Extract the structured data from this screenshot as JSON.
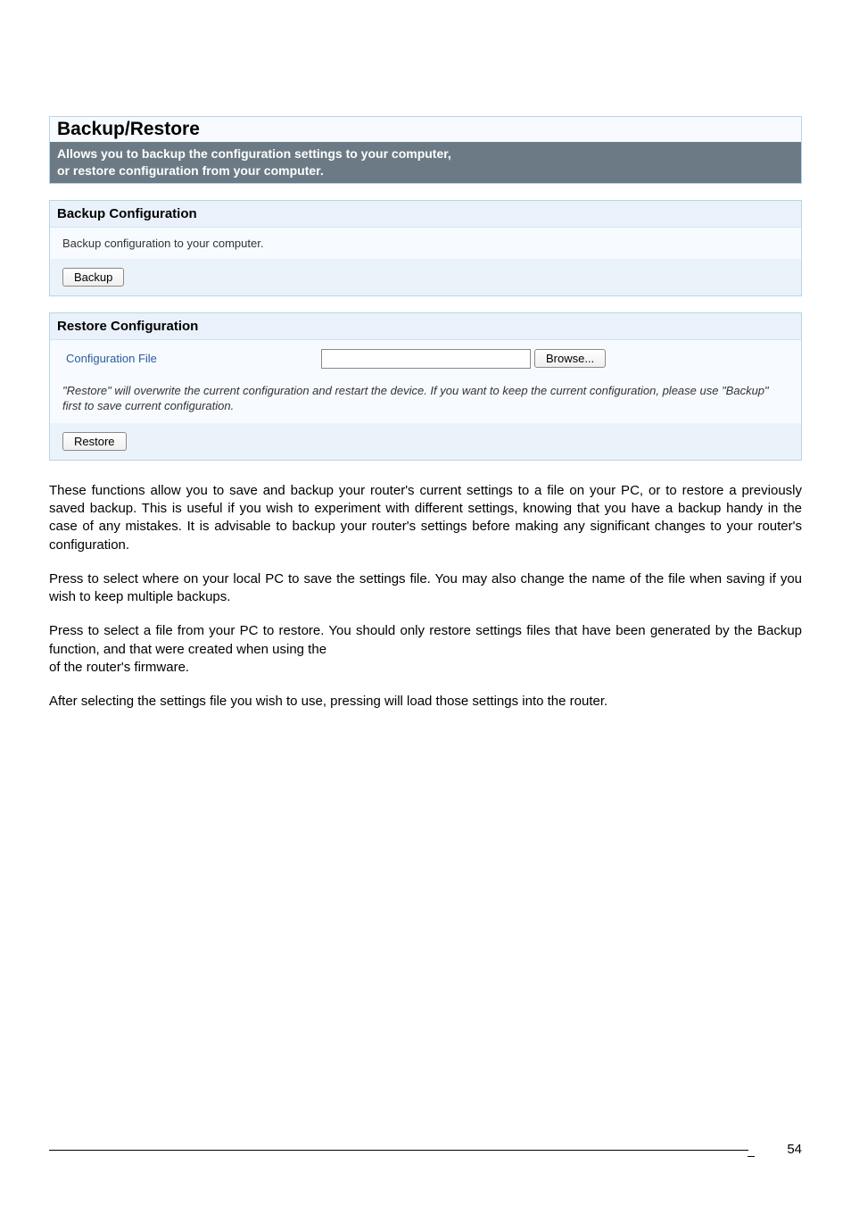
{
  "panel": {
    "title": "Backup/Restore",
    "sub_line1": "Allows you to backup the configuration settings to your computer,",
    "sub_line2": "or restore configuration from your computer."
  },
  "backup": {
    "heading": "Backup Configuration",
    "desc": "Backup configuration to your computer.",
    "button": "Backup"
  },
  "restore": {
    "heading": "Restore Configuration",
    "file_label": "Configuration File",
    "file_value": "",
    "browse": "Browse...",
    "note": "\"Restore\" will overwrite the current configuration and restart the device. If you want to keep the current configuration, please use \"Backup\" first to save current configuration.",
    "button": "Restore"
  },
  "doc": {
    "p1": "These functions allow you to save and backup your router's current settings to a file on your PC, or to restore a previously saved backup. This is useful if you wish to experiment with different settings, knowing that you have a backup handy in the case of any mistakes. It is advisable to backup your router's settings before making any significant changes to your router's configuration.",
    "p2_a": "Press ",
    "p2_b": " to select where on your local PC to save the settings file. You may also change the name of the file when saving if you wish to keep multiple backups.",
    "p3_a": "Press ",
    "p3_b": " to select a file from your PC to restore. You should only restore settings files that have been generated by the Backup function, and that were created when using the ",
    "p3_c": " of the router's firmware.",
    "p4_a": "After selecting the settings file you wish to use, pressing ",
    "p4_b": " will load those settings into the router."
  },
  "page_number": "54"
}
